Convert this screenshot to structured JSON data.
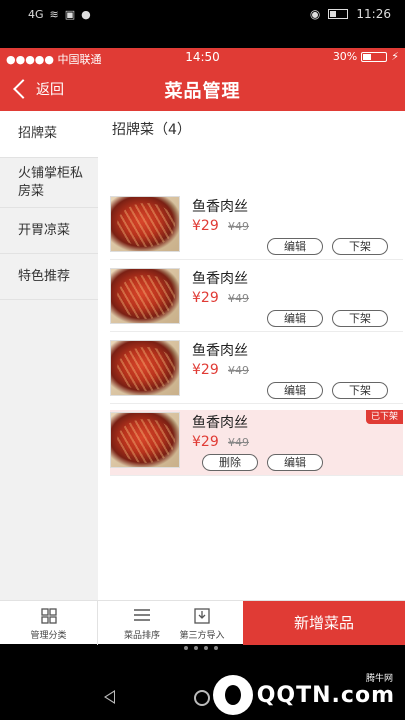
{
  "system_status": {
    "carrier_icons": "4G",
    "time": "11:26"
  },
  "ios_status": {
    "carrier": "●●●●● 中国联通",
    "time": "14:50",
    "battery": "30%"
  },
  "header": {
    "back_label": "返回",
    "title": "菜品管理"
  },
  "sidebar": {
    "items": [
      {
        "label": "招牌菜",
        "active": true
      },
      {
        "label": "火铺掌柜私房菜",
        "active": false
      },
      {
        "label": "开胃凉菜",
        "active": false
      },
      {
        "label": "特色推荐",
        "active": false
      }
    ]
  },
  "main": {
    "section_title": "招牌菜（4）",
    "items": [
      {
        "name": "鱼香肉丝",
        "price": "¥29",
        "old_price": "¥49",
        "btn1": "编辑",
        "btn2": "下架"
      },
      {
        "name": "鱼香肉丝",
        "price": "¥29",
        "old_price": "¥49",
        "btn1": "编辑",
        "btn2": "下架"
      },
      {
        "name": "鱼香肉丝",
        "price": "¥29",
        "old_price": "¥49",
        "btn1": "编辑",
        "btn2": "下架"
      },
      {
        "name": "鱼香肉丝",
        "price": "¥29",
        "old_price": "¥49",
        "btn1": "删除",
        "btn2": "编辑",
        "badge": "已下架"
      }
    ]
  },
  "bottom": {
    "manage_category": "管理分类",
    "sort_dishes": "菜品排序",
    "third_party_import": "第三方导入",
    "add_dish": "新增菜品"
  },
  "watermark": {
    "text": "QQTN.com",
    "site": "腾牛网"
  },
  "colors": {
    "accent": "#e03b35",
    "off_bg": "#fbe7e7"
  }
}
